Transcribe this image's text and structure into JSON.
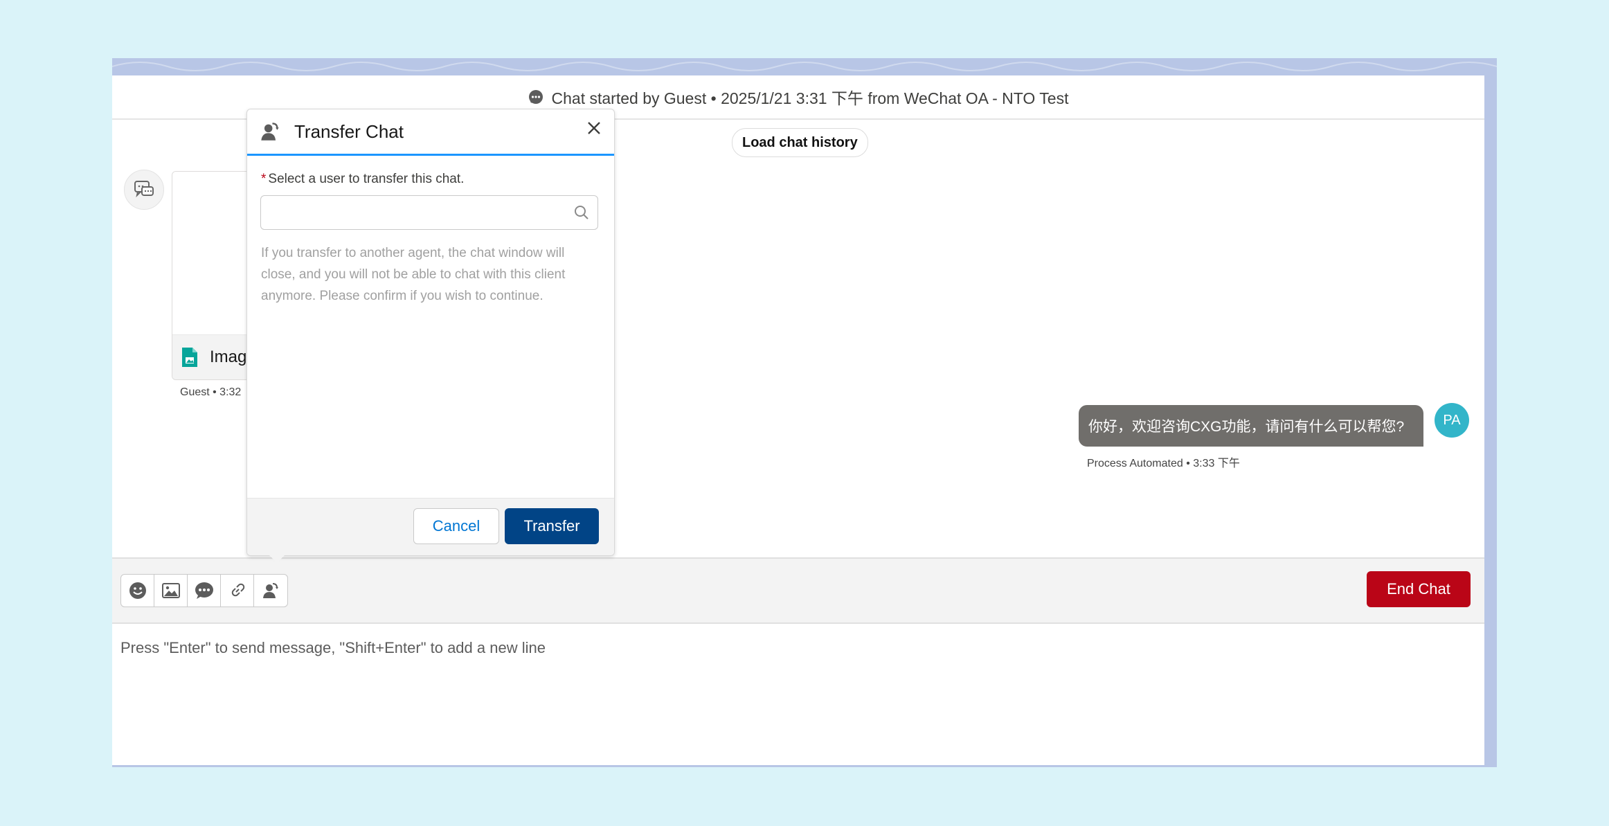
{
  "header": {
    "chat_started": "Chat started by Guest • 2025/1/21 3:31 下午 from WeChat OA - NTO Test"
  },
  "history": {
    "load_label": "Load chat history"
  },
  "messages": {
    "guest_attachment_name": "Imag",
    "guest_meta": "Guest • 3:32 ",
    "agent_text": "你好，欢迎咨询CXG功能，请问有什么可以帮您?",
    "agent_avatar": "PA",
    "agent_meta": "Process Automated • 3:33 下午"
  },
  "transfer": {
    "title": "Transfer Chat",
    "field_label": "Select a user to transfer this chat.",
    "required_mark": "*",
    "search_value": "",
    "note": "If you transfer to another agent, the chat window will close, and you will not be able to chat with this client anymore. Please confirm if you wish to continue.",
    "cancel_label": "Cancel",
    "transfer_label": "Transfer"
  },
  "toolbar": {
    "tools": [
      "emoji-icon",
      "image-icon",
      "quick-text-icon",
      "link-icon",
      "transfer-icon"
    ],
    "end_chat_label": "End Chat"
  },
  "composer": {
    "placeholder": "Press \"Enter\" to send message, \"Shift+Enter\" to add a new line"
  },
  "colors": {
    "background": "#daf3f9",
    "end_chat": "#ba0517",
    "transfer_button": "#014486",
    "agent_bubble": "#706e6b",
    "avatar": "#32b5c9",
    "accent": "#1b96ff"
  }
}
